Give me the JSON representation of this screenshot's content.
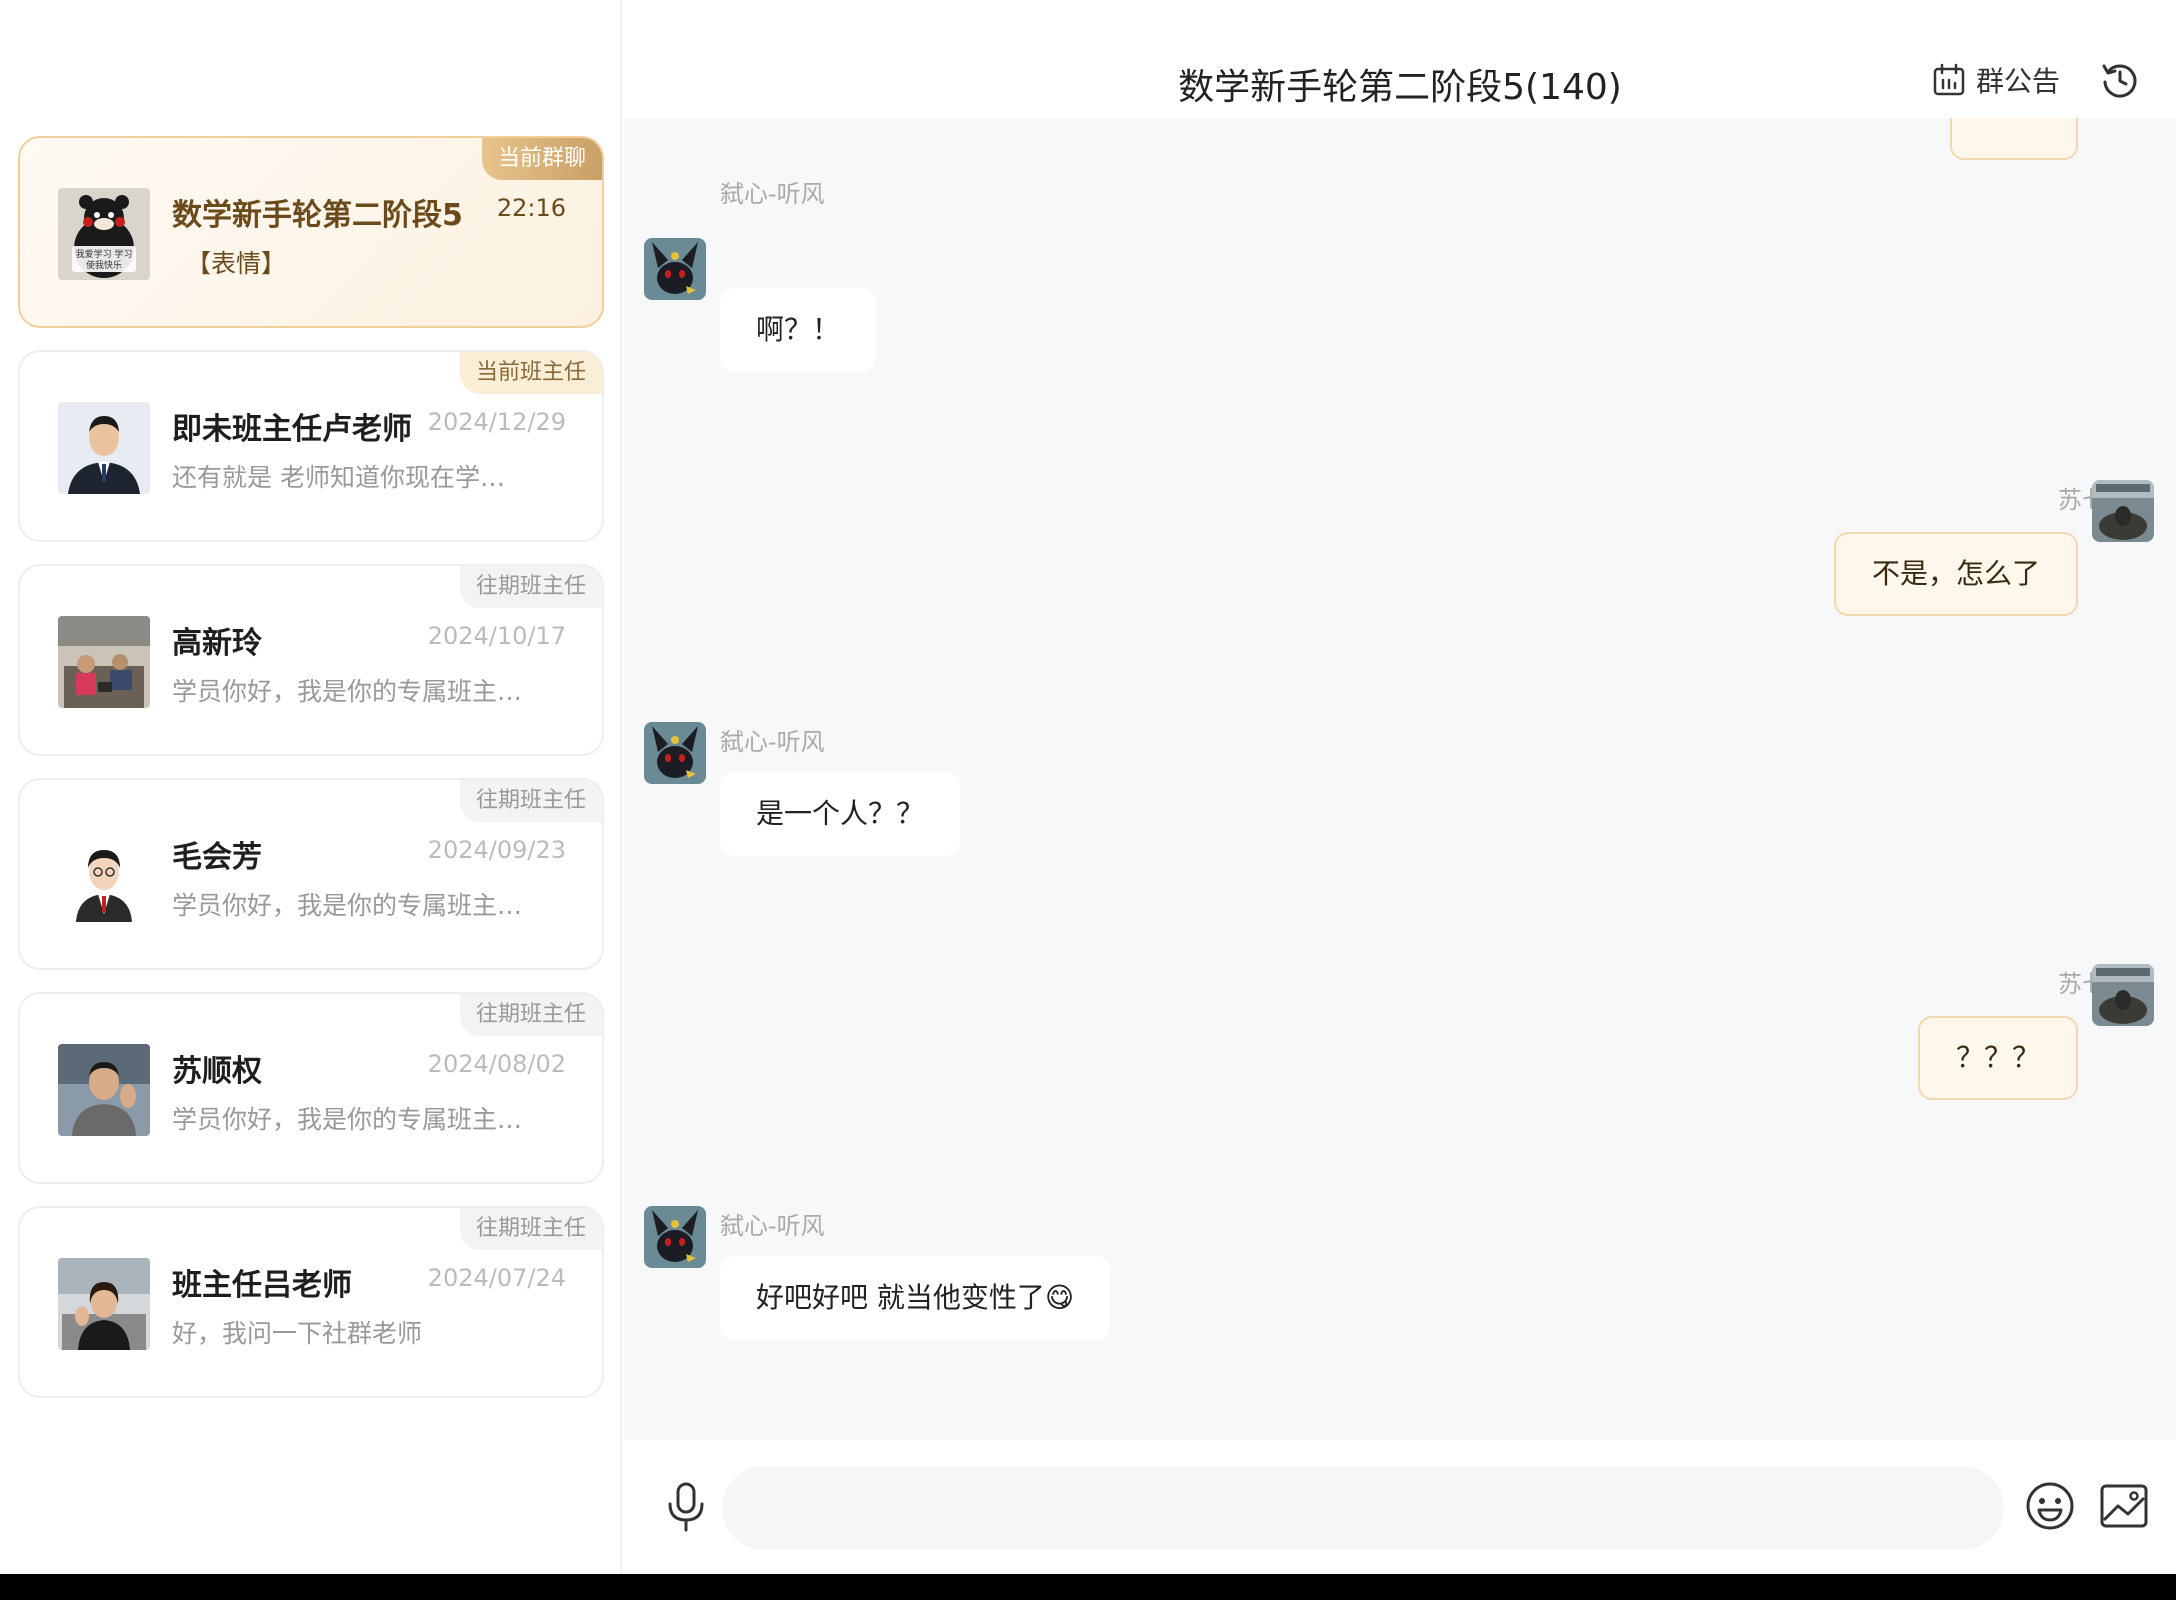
{
  "sidebar": {
    "conversations": [
      {
        "name": "数学新手轮第二阶段5",
        "time": "22:16",
        "preview": "【表情】",
        "badge": "当前群聊",
        "active": true,
        "avatar_text": "我爱学习 学习使我快乐"
      },
      {
        "name": "即未班主任卢老师",
        "time": "2024/12/29",
        "preview": "还有就是 老师知道你现在学…",
        "badge": "当前班主任",
        "active": false
      },
      {
        "name": "高新玲",
        "time": "2024/10/17",
        "preview": "学员你好，我是你的专属班主…",
        "badge": "往期班主任",
        "active": false
      },
      {
        "name": "毛会芳",
        "time": "2024/09/23",
        "preview": "学员你好，我是你的专属班主…",
        "badge": "往期班主任",
        "active": false
      },
      {
        "name": "苏顺权",
        "time": "2024/08/02",
        "preview": "学员你好，我是你的专属班主…",
        "badge": "往期班主任",
        "active": false
      },
      {
        "name": "班主任吕老师",
        "time": "2024/07/24",
        "preview": "好，我问一下社群老师",
        "badge": "往期班主任",
        "active": false
      }
    ]
  },
  "chat": {
    "title": "数学新手轮第二阶段5(140)",
    "notice_label": "群公告",
    "messages": [
      {
        "side": "left",
        "sender": "弑心-听风",
        "text": "啊？！"
      },
      {
        "side": "right",
        "sender": "苏七",
        "text": "不是，怎么了"
      },
      {
        "side": "left",
        "sender": "弑心-听风",
        "text": "是一个人？？"
      },
      {
        "side": "right",
        "sender": "苏七",
        "text": "？？？"
      },
      {
        "side": "left",
        "sender": "弑心-听风",
        "text": "好吧好吧 就当他变性了😋"
      }
    ]
  },
  "input": {
    "value": "",
    "placeholder": ""
  },
  "icons": {
    "notice": "calendar-icon",
    "history": "history-clock-icon",
    "mic": "microphone-icon",
    "emoji": "smiley-icon",
    "image": "image-icon"
  },
  "colors": {
    "accent_gold": "#c9a066",
    "active_card_border": "#f0cf9b",
    "bubble_self_bg": "#fdf7ec",
    "chat_bg": "#f7f8fa"
  }
}
